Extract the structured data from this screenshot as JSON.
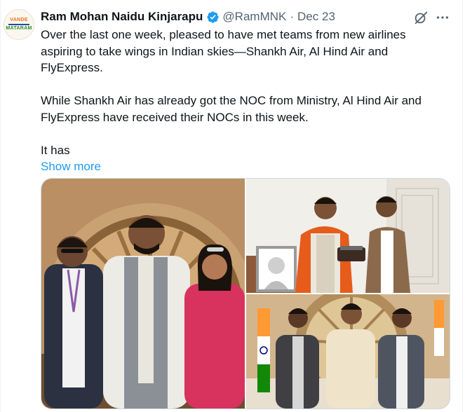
{
  "tweet": {
    "avatar_text": {
      "top": "VANDE",
      "bottom": "MATARAM"
    },
    "author_name": "Ram Mohan Naidu Kinjarapu",
    "handle": "@RamMNK",
    "separator": "·",
    "date": "Dec 23",
    "paragraph1": "Over the last one week, pleased to have met teams from new airlines aspiring to take wings in Indian skies—Shankh Air, Al Hind Air and FlyExpress.",
    "paragraph2": "While Shankh Air has already got the NOC from Ministry, Al Hind Air and FlyExpress have received their NOCs in this week.",
    "paragraph3": "It has",
    "show_more": "Show more"
  },
  "icons": {
    "verified": "verified-badge-icon",
    "grok": "grok-icon",
    "more": "more-options-icon"
  },
  "colors": {
    "accent": "#1d9bf0",
    "text": "#0f1419",
    "secondary": "#536471",
    "border": "#cfd9de"
  }
}
